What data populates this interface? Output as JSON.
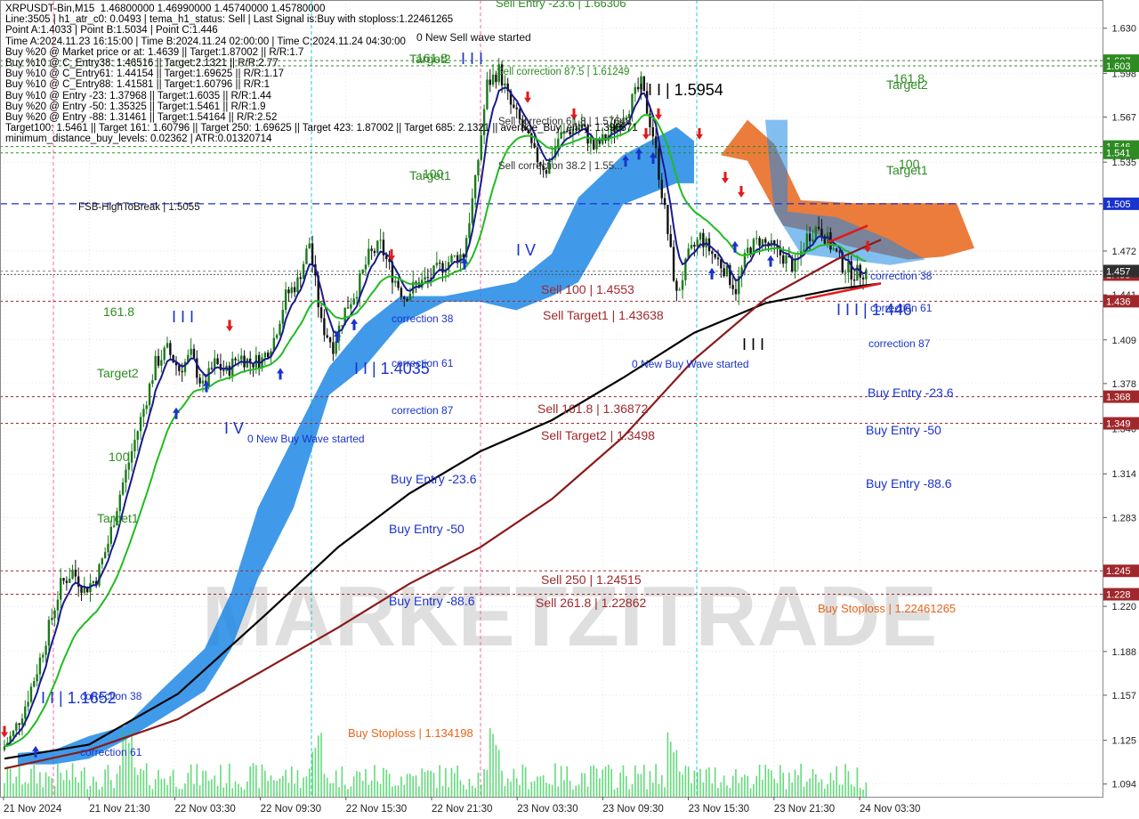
{
  "chart_data": {
    "type": "candlestick",
    "symbol_header": "XRPUSDT-Bin,M15  1.46800000 1.46990000 1.45740000 1.45780000",
    "info_lines": [
      "Line:3505 | h1_atr_c0: 0.0493 | tema_h1_status: Sell | Last Signal is:Buy with stoploss:1.22461265",
      "Point A:1.4033 | Point B:1.5034 | Point C:1.446",
      "Time A:2024.11.23 16:15:00 | Time B:2024.11.24 02:00:00 | Time C:2024.11.24 04:30:00",
      "Buy %20 @ Market price or at: 1.4639 || Target:1.87002 || R/R:1.7",
      "Buy %10 @ C_Entry38: 1.46516 || Target:2.1321 || R/R:2.77",
      "Buy %10 @ C_Entry61: 1.44154 || Target:1.69625 || R/R:1.17",
      "Buy %10 @ C_Entry88: 1.41581 || Target:1.60796 || R/R:1",
      "Buy %10 @ Entry -23: 1.37968 || Target:1.6035 || R/R:1.44",
      "Buy %20 @ Entry -50: 1.35325 || Target:1.5461 || R/R:1.9",
      "Buy %20 @ Entry -88: 1.31461 || Target:1.54164 || R/R:2.52",
      "Target100: 1.5461 || Target 161: 1.60796 || Target 250: 1.69625 || Target 423: 1.87002 || Target 685: 2.1321 || average_Buy_entry: 1.396571",
      "minimum_distance_buy_levels: 0.02362 | ATR:0.01320714"
    ],
    "y_axis_ticks": [
      {
        "label": "1.630",
        "v": 1.63
      },
      {
        "label": "1.598",
        "v": 1.598
      },
      {
        "label": "1.567",
        "v": 1.567
      },
      {
        "label": "1.535",
        "v": 1.535
      },
      {
        "label": "1.472",
        "v": 1.472
      },
      {
        "label": "1.441",
        "v": 1.441
      },
      {
        "label": "1.409",
        "v": 1.409
      },
      {
        "label": "1.378",
        "v": 1.378
      },
      {
        "label": "1.346",
        "v": 1.346
      },
      {
        "label": "1.314",
        "v": 1.314
      },
      {
        "label": "1.283",
        "v": 1.283
      },
      {
        "label": "1.220",
        "v": 1.22
      },
      {
        "label": "1.188",
        "v": 1.188
      },
      {
        "label": "1.157",
        "v": 1.157
      },
      {
        "label": "1.125",
        "v": 1.125
      },
      {
        "label": "1.094",
        "v": 1.094
      }
    ],
    "price_tags": [
      {
        "label": "1.607",
        "v": 1.607,
        "color": "#2e8b22"
      },
      {
        "label": "1.603",
        "v": 1.6033,
        "color": "#2e8b22"
      },
      {
        "label": "1.546",
        "v": 1.5461,
        "color": "#2e8b22"
      },
      {
        "label": "1.541",
        "v": 1.5416,
        "color": "#2e8b22"
      },
      {
        "label": "1.505",
        "v": 1.5055,
        "color": "#1a33cc"
      },
      {
        "label": "1.455",
        "v": 1.4553,
        "color": "#a0282c"
      },
      {
        "label": "1.436",
        "v": 1.4364,
        "color": "#a0282c"
      },
      {
        "label": "1.368",
        "v": 1.3687,
        "color": "#a0282c"
      },
      {
        "label": "1.349",
        "v": 1.3498,
        "color": "#a0282c"
      },
      {
        "label": "1.245",
        "v": 1.2452,
        "color": "#a0282c"
      },
      {
        "label": "1.228",
        "v": 1.2286,
        "color": "#a0282c"
      },
      {
        "label": "1.457",
        "v": 1.4578,
        "color": "#2f2f2f"
      }
    ],
    "x_axis_labels": [
      "21 Nov 2024",
      "21 Nov 21:30",
      "22 Nov 03:30",
      "22 Nov 09:30",
      "22 Nov 15:30",
      "22 Nov 21:30",
      "23 Nov 03:30",
      "23 Nov 09:30",
      "23 Nov 15:30",
      "23 Nov 21:30",
      "24 Nov 03:30"
    ],
    "ylim": [
      1.085,
      1.65
    ],
    "close_path": [
      1.118,
      1.13,
      1.15,
      1.175,
      1.205,
      1.235,
      1.245,
      1.232,
      1.24,
      1.265,
      1.3,
      1.33,
      1.36,
      1.392,
      1.402,
      1.388,
      1.398,
      1.375,
      1.392,
      1.386,
      1.398,
      1.393,
      1.395,
      1.41,
      1.44,
      1.45,
      1.478,
      1.42,
      1.405,
      1.43,
      1.445,
      1.468,
      1.476,
      1.455,
      1.44,
      1.448,
      1.452,
      1.46,
      1.466,
      1.47,
      1.52,
      1.59,
      1.6,
      1.575,
      1.56,
      1.54,
      1.53,
      1.552,
      1.558,
      1.56,
      1.545,
      1.552,
      1.562,
      1.575,
      1.59,
      1.555,
      1.5,
      1.44,
      1.468,
      1.482,
      1.47,
      1.46,
      1.445,
      1.472,
      1.48,
      1.474,
      1.468,
      1.46,
      1.482,
      1.49,
      1.476,
      1.462,
      1.456,
      1.458
    ],
    "annotations": {
      "sell_entry_top": "Sell Entry -23.6 | 1.66306",
      "new_sell_wave": "0 New Sell wave started",
      "sell_correction_875": "Sell correction 87.5 | 1.61249",
      "sell_correction_618": "Sell correction 61.8 | 1.57648",
      "sell_correction_382": "Sell correction 38.2 | 1.55...",
      "peak_label": "I I I | 1.5954",
      "fsb": "FSB-HighToBreak | 1.5055",
      "sell_100": "Sell 100 | 1.4553",
      "sell_target1": "Sell Target1 | 1.43638",
      "sell_1618": "Sell 161.8 | 1.36872",
      "sell_target2": "Sell Target2 | 1.3498",
      "sell_250": "Sell  250 | 1.24515",
      "sell_2618": "Sell  261.8 | 1.22862",
      "buy_stoploss_1": "Buy Stoploss | 1.134198",
      "buy_stoploss_2": "Buy Stoploss | 1.22461265",
      "point_a": "I I | 1.4035",
      "point_c": "I I I | 1.446",
      "low_left": "I I | 1.1652",
      "new_buy_wave_1": "0 New Buy Wave started",
      "new_buy_wave_2": "0 New Buy Wave started",
      "corr38_a": "correction 38",
      "corr61_a": "correction 61",
      "corr87_a": "correction 87",
      "corr38_b": "correction 38",
      "corr61_b": "correction 61",
      "corr87_b": "correction 87",
      "corr38_c": "correction 38",
      "corr61_c": "correction 61",
      "buy_entry_236_a": "Buy Entry -23.6",
      "buy_entry_50_a": "Buy Entry -50",
      "buy_entry_886_a": "Buy Entry -88.6",
      "buy_entry_236_b": "Buy Entry -23.6",
      "buy_entry_50_b": "Buy Entry -50",
      "buy_entry_886_b": "Buy Entry -88.6",
      "target1_a": "Target1",
      "target2_a": "Target2",
      "target1_b": "Target1",
      "target2_b": "Target2",
      "target1_c": "Target1",
      "target2_c": "Target2",
      "t100_a": "100",
      "t1618_a": "161.8",
      "t100_b": "100",
      "t1618_b": "161.8",
      "t100_c": "100",
      "t1618_c": "161.8",
      "roman_iii_a": "I I I",
      "roman_iv_a": "I V",
      "roman_iii_top": "I I I",
      "roman_iv_b": "I V",
      "roman_iii_b": "I I I"
    },
    "watermark": "MARKETZITRADE",
    "colors": {
      "grid": "#d6d6d6",
      "bull_candle": "#1a7a1a",
      "bear_candle": "#111111",
      "ichimoku_blue": "#1e88e5",
      "ichimoku_orange": "#e8651a",
      "ma_navy": "#1a1a8c",
      "ma_green": "#22bb22",
      "ma_black": "#000000",
      "ma_maroon": "#8b1a1a",
      "level_green": "#2e8b22",
      "level_red": "#a0282c",
      "level_blue": "#1a33cc",
      "text_blue": "#1a33cc",
      "text_red": "#a0282c",
      "text_green": "#2e8b22",
      "text_orange": "#e8651a",
      "vline_pink": "#ff66aa",
      "vline_cyan": "#22cccc",
      "volume": "#22cc44"
    }
  }
}
